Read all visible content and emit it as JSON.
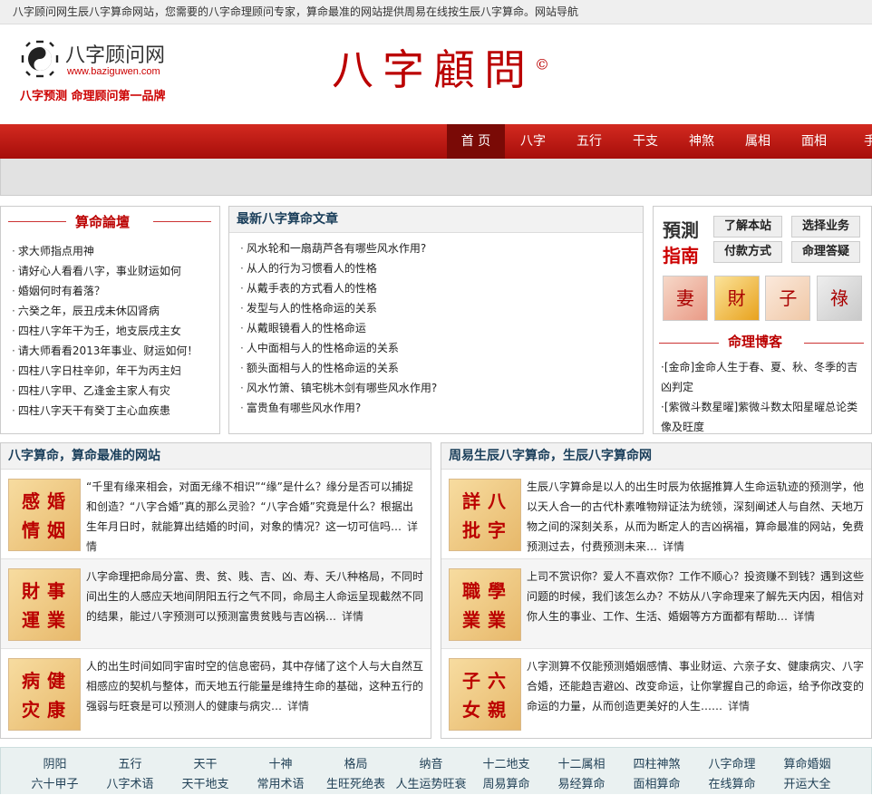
{
  "topbar": {
    "text": "八字顾问网生辰八字算命网站，您需要的八字命理顾问专家，算命最准的网站提供周易在线按生辰八字算命。网站导航"
  },
  "header": {
    "logo_title": "八字顾问网",
    "logo_url": "www.baziguwen.com",
    "slogan": "八字预测  命理顾问第一品牌",
    "brand": "八字顧問",
    "brand_mark": "©"
  },
  "nav": {
    "items": [
      "首 页",
      "八字",
      "五行",
      "干支",
      "神煞",
      "属相",
      "面相",
      "手"
    ],
    "active_index": 0
  },
  "forum": {
    "title": "算命論壇",
    "items": [
      "求大师指点用神",
      "请好心人看看八字，事业财运如何",
      "婚姻何时有着落？",
      "六癸之年，辰丑戌未休囚肾病",
      "四柱八字年干为壬，地支辰戌主女",
      "请大师看看2013年事业、财运如何！",
      "四柱八字日柱辛卯，年干为丙主妇",
      "四柱八字甲、乙逢金主家人有灾",
      "四柱八字天干有癸丁主心血疾患"
    ]
  },
  "articles": {
    "title": "最新八字算命文章",
    "items": [
      "风水轮和一扇葫芦各有哪些风水作用?",
      "从人的行为习惯看人的性格",
      "从戴手表的方式看人的性格",
      "发型与人的性格命运的关系",
      "从戴眼镜看人的性格命运",
      "人中面相与人的性格命运的关系",
      "额头面相与人的性格命运的关系",
      "风水竹箫、镇宅桃木剑有哪些风水作用?",
      "富贵鱼有哪些风水作用?"
    ]
  },
  "guide": {
    "title1": "預測",
    "title2": "指南",
    "buttons": [
      "了解本站",
      "选择业务",
      "付款方式",
      "命理答疑"
    ],
    "icons": [
      {
        "name": "wife-icon",
        "label": "妻"
      },
      {
        "name": "wealth-icon",
        "label": "財"
      },
      {
        "name": "child-icon",
        "label": "子"
      },
      {
        "name": "fortune-icon",
        "label": "祿"
      }
    ],
    "blog_title": "命理博客",
    "blog_items": [
      "·[金命]金命人生于春、夏、秋、冬季的吉凶判定",
      "·[紫微斗数星曜]紫微斗数太阳星曜总论类像及旺度"
    ]
  },
  "left_section": {
    "title": "八字算命，算命最准的网站",
    "features": [
      {
        "chars": [
          "婚",
          "姻",
          "感",
          "情"
        ],
        "text": "“千里有缘来相会，对面无缘不相识”“缘”是什么？缘分是否可以捕捉和创造？“八字合婚”真的那么灵验？“八字合婚”究竟是什么？根据出生年月日时，就能算出结婚的时间，对象的情况？这一切可信吗…",
        "more": "详情"
      },
      {
        "chars": [
          "事",
          "業",
          "財",
          "運"
        ],
        "text": "八字命理把命局分富、贵、贫、贱、吉、凶、寿、夭八种格局，不同时间出生的人感应天地间阴阳五行之气不同，命局主人命运呈现截然不同的结果，能过八字预测可以预测富贵贫贱与吉凶祸…",
        "more": "详情"
      },
      {
        "chars": [
          "健",
          "康",
          "病",
          "灾"
        ],
        "text": "人的出生时间如同宇宙时空的信息密码，其中存储了这个人与大自然互相感应的契机与整体，而天地五行能量是维持生命的基础，这种五行的强弱与旺衰是可以预测人的健康与病灾…",
        "more": "详情"
      }
    ]
  },
  "right_section": {
    "title": "周易生辰八字算命，生辰八字算命网",
    "features": [
      {
        "chars": [
          "八",
          "字",
          "詳",
          "批"
        ],
        "text": "生辰八字算命是以人的出生时辰为依据推算人生命运轨迹的预测学，他以天人合一的古代朴素唯物辩证法为统领，深刻阐述人与自然、天地万物之间的深刻关系，从而为断定人的吉凶祸福，算命最准的网站，免费预测过去，付费预测未来…",
        "more": "详情"
      },
      {
        "chars": [
          "學",
          "業",
          "職",
          "業"
        ],
        "text": "上司不赏识你？爱人不喜欢你？工作不顺心？投资赚不到钱？遇到这些问题的时候，我们该怎么办？不妨从八字命理来了解先天内因，相信对你人生的事业、工作、生活、婚姻等方方面都有帮助…",
        "more": "详情"
      },
      {
        "chars": [
          "六",
          "親",
          "子",
          "女"
        ],
        "text": "八字测算不仅能预测婚姻感情、事业财运、六亲子女、健康病灾、八字合婚，还能趋吉避凶、改变命运，让你掌握自己的命运，给予你改变的命运的力量，从而创造更美好的人生……",
        "more": "详情"
      }
    ]
  },
  "footer": {
    "row1": [
      "阴阳",
      "五行",
      "天干",
      "十神",
      "格局",
      "纳音",
      "十二地支",
      "十二属相",
      "四柱神煞",
      "八字命理",
      "算命婚姻"
    ],
    "row2": [
      "六十甲子",
      "八字术语",
      "天干地支",
      "常用术语",
      "生旺死绝表",
      "人生运势旺衰",
      "周易算命",
      "易经算命",
      "面相算命",
      "在线算命",
      "开运大全"
    ]
  }
}
